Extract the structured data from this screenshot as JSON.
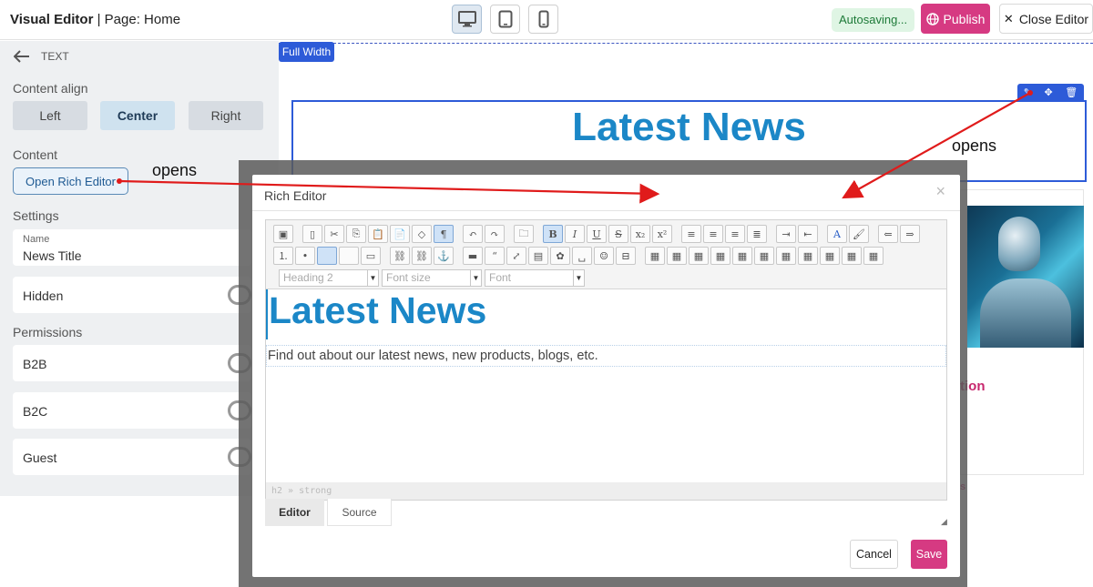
{
  "header": {
    "app_name": "Visual Editor",
    "separator": " | ",
    "page_label": "Page: Home",
    "device_buttons": [
      "desktop-icon",
      "tablet-icon",
      "mobile-icon"
    ],
    "autosave": "Autosaving...",
    "publish": "Publish",
    "close": "Close Editor"
  },
  "sidebar": {
    "back_label": "TEXT",
    "content_align_label": "Content align",
    "align_options": [
      "Left",
      "Center",
      "Right"
    ],
    "align_selected": "Center",
    "content_label": "Content",
    "rich_editor_button": "Open Rich Editor",
    "settings_label": "Settings",
    "name_field_label": "Name",
    "name_field_value": "News Title",
    "hidden_label": "Hidden",
    "permissions_label": "Permissions",
    "permissions": [
      "B2B",
      "B2C",
      "Guest"
    ]
  },
  "canvas": {
    "full_width_badge": "Full Width",
    "news_heading": "Latest News",
    "card_link_fragment": "tion",
    "card_link_fragment2": "s"
  },
  "annotations": {
    "opens_left": "opens",
    "opens_right": "opens"
  },
  "modal": {
    "title": "Rich Editor",
    "close": "×",
    "format_select": "Heading 2",
    "size_select": "Font size",
    "font_select": "Font",
    "heading": "Latest News",
    "paragraph": "Find out about our latest news, new products, blogs, etc.",
    "status_path": "h2 » strong",
    "tabs": [
      "Editor",
      "Source"
    ],
    "cancel": "Cancel",
    "save": "Save"
  },
  "colors": {
    "accent": "#d63a82",
    "heading_blue": "#1b87c7",
    "selection_blue": "#2d5bd8",
    "arrow_red": "#e01b1b"
  }
}
